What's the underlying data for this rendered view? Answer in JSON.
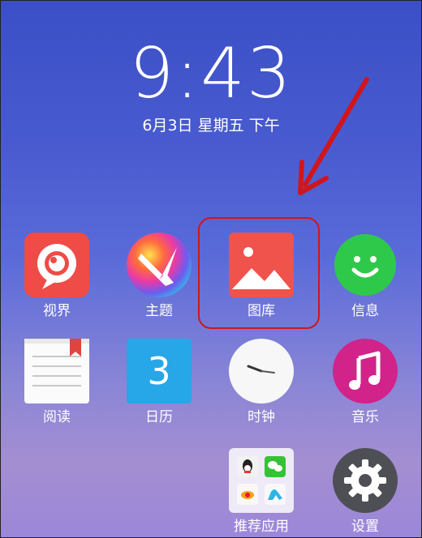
{
  "lockscreen": {
    "time": "9:43",
    "date": "6月3日 星期五 下午"
  },
  "apps": [
    {
      "label": "视界",
      "icon": "shijie-icon"
    },
    {
      "label": "主题",
      "icon": "theme-icon"
    },
    {
      "label": "图库",
      "icon": "gallery-icon"
    },
    {
      "label": "信息",
      "icon": "messages-icon"
    },
    {
      "label": "阅读",
      "icon": "reader-icon"
    },
    {
      "label": "日历",
      "icon": "calendar-icon",
      "badge": "3"
    },
    {
      "label": "时钟",
      "icon": "clock-icon"
    },
    {
      "label": "音乐",
      "icon": "music-icon"
    },
    {
      "label": "推荐应用",
      "icon": "recommended-apps-folder-icon"
    },
    {
      "label": "设置",
      "icon": "settings-icon"
    }
  ],
  "colors": {
    "annotation_red": "#d0161c",
    "shijie_red": "#ef4b47",
    "gallery_red": "#f0524c",
    "messages_green": "#2ec94a",
    "calendar_blue": "#27a6e8",
    "music_magenta": "#d2238a",
    "settings_gray": "#4d4f55"
  }
}
